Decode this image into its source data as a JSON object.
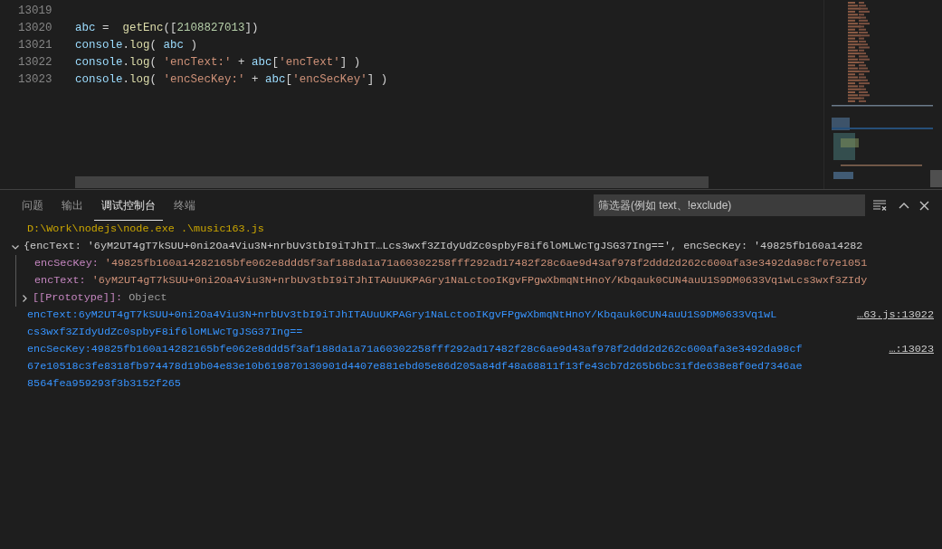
{
  "editor": {
    "lines": [
      {
        "number": "13019"
      },
      {
        "number": "13020",
        "tokens": [
          {
            "text": "abc",
            "kind": "var"
          },
          {
            "text": " =  ",
            "kind": "plain"
          },
          {
            "text": "getEnc",
            "kind": "func"
          },
          {
            "text": "([",
            "kind": "plain"
          },
          {
            "text": "2108827013",
            "kind": "num"
          },
          {
            "text": "])",
            "kind": "plain"
          }
        ]
      },
      {
        "number": "13021",
        "tokens": [
          {
            "text": "console",
            "kind": "var"
          },
          {
            "text": ".",
            "kind": "plain"
          },
          {
            "text": "log",
            "kind": "func"
          },
          {
            "text": "( ",
            "kind": "plain"
          },
          {
            "text": "abc",
            "kind": "var"
          },
          {
            "text": " )",
            "kind": "plain"
          }
        ]
      },
      {
        "number": "13022",
        "tokens": [
          {
            "text": "console",
            "kind": "var"
          },
          {
            "text": ".",
            "kind": "plain"
          },
          {
            "text": "log",
            "kind": "func"
          },
          {
            "text": "( ",
            "kind": "plain"
          },
          {
            "text": "'encText:'",
            "kind": "str"
          },
          {
            "text": " + ",
            "kind": "plain"
          },
          {
            "text": "abc",
            "kind": "var"
          },
          {
            "text": "[",
            "kind": "plain"
          },
          {
            "text": "'encText'",
            "kind": "str"
          },
          {
            "text": "] )",
            "kind": "plain"
          }
        ]
      },
      {
        "number": "13023",
        "tokens": [
          {
            "text": "console",
            "kind": "var"
          },
          {
            "text": ".",
            "kind": "plain"
          },
          {
            "text": "log",
            "kind": "func"
          },
          {
            "text": "( ",
            "kind": "plain"
          },
          {
            "text": "'encSecKey:'",
            "kind": "str"
          },
          {
            "text": " + ",
            "kind": "plain"
          },
          {
            "text": "abc",
            "kind": "var"
          },
          {
            "text": "[",
            "kind": "plain"
          },
          {
            "text": "'encSecKey'",
            "kind": "str"
          },
          {
            "text": "] )",
            "kind": "plain"
          }
        ]
      }
    ]
  },
  "panel": {
    "tabs": [
      {
        "label": "问题",
        "selected": false
      },
      {
        "label": "输出",
        "selected": false
      },
      {
        "label": "调试控制台",
        "selected": true
      },
      {
        "label": "终端",
        "selected": false
      }
    ],
    "filter": {
      "placeholder": "筛选器(例如 text、!exclude)"
    },
    "entries": [
      {
        "kind": "path",
        "text": "D:\\Work\\nodejs\\node.exe .\\music163.js"
      },
      {
        "kind": "object",
        "expanded": true,
        "summary": "{encText: '6yM2UT4gT7kSUU+0ni2Oa4Viu3N+nrbUv3tbI9iTJhIT…Lcs3wxf3ZIdyUdZc0spbyF8if6loMLWcTgJSG37Ing==', encSecKey: '49825fb160a14282",
        "properties": [
          {
            "key": "encSecKey:",
            "value": "'49825fb160a14282165bfe062e8ddd5f3af188da1a71a60302258fff292ad17482f28c6ae9d43af978f2ddd2d262c600afa3e3492da98cf67e1051"
          },
          {
            "key": "encText:",
            "value": "'6yM2UT4gT7kSUU+0ni2Oa4Viu3N+nrbUv3tbI9iTJhITAUuUKPAGry1NaLctooIKgvFPgwXbmqNtHnoY/Kbqauk0CUN4auU1S9DM0633Vq1wLcs3wxf3ZIdy"
          }
        ],
        "prototype": {
          "label": "[[Prototype]]:",
          "value": "Object",
          "expanded": false
        }
      },
      {
        "kind": "log",
        "source": "…63.js:13022",
        "lines": [
          "encText:6yM2UT4gT7kSUU+0ni2Oa4Viu3N+nrbUv3tbI9iTJhITAUuUKPAGry1NaLctooIKgvFPgwXbmqNtHnoY/Kbqauk0CUN4auU1S9DM0633Vq1wL",
          "cs3wxf3ZIdyUdZc0spbyF8if6loMLWcTgJSG37Ing=="
        ]
      },
      {
        "kind": "log",
        "source": "…:13023",
        "lines": [
          "encSecKey:49825fb160a14282165bfe062e8ddd5f3af188da1a71a60302258fff292ad17482f28c6ae9d43af978f2ddd2d262c600afa3e3492da98cf",
          "67e10518c3fe8318fb974478d19b04e83e10b619870130901d4407e881ebd05e86d205a84df48a68811f13fe43cb7d265b6bc31fde638e8f0ed7346ae",
          "8564fea959293f3b3152f265"
        ]
      }
    ]
  }
}
